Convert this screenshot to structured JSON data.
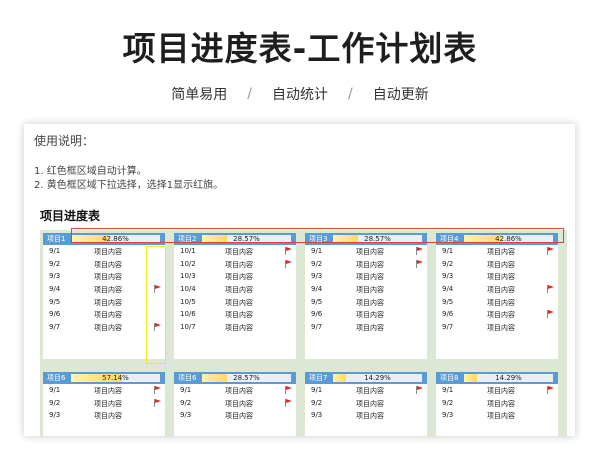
{
  "header": {
    "title": "项目进度表-工作计划表",
    "features": [
      "简单易用",
      "自动统计",
      "自动更新"
    ],
    "separator": "/"
  },
  "instructions": {
    "heading": "使用说明：",
    "lines": [
      "1. 红色框区域自动计算。",
      "2. 黄色框区域下拉选择，选择1显示红旗。"
    ]
  },
  "table_title": "项目进度表",
  "colors": {
    "header_bar": "#5b9bd5",
    "panel_bg": "#dde8d4",
    "flag": "#e02a20",
    "calc_box": "#e0423a",
    "select_box": "#f2ea1c"
  },
  "cards": [
    {
      "name": "项目1",
      "progress": "42.86%",
      "progress_value": 0.4286,
      "rows": [
        {
          "date": "9/1",
          "content": "项目内容",
          "flag": false
        },
        {
          "date": "9/2",
          "content": "项目内容",
          "flag": false
        },
        {
          "date": "9/3",
          "content": "项目内容",
          "flag": false
        },
        {
          "date": "9/4",
          "content": "项目内容",
          "flag": true
        },
        {
          "date": "9/5",
          "content": "项目内容",
          "flag": false
        },
        {
          "date": "9/6",
          "content": "项目内容",
          "flag": false
        },
        {
          "date": "9/7",
          "content": "项目内容",
          "flag": true
        }
      ]
    },
    {
      "name": "项目2",
      "progress": "28.57%",
      "progress_value": 0.2857,
      "rows": [
        {
          "date": "10/1",
          "content": "项目内容",
          "flag": true
        },
        {
          "date": "10/2",
          "content": "项目内容",
          "flag": true
        },
        {
          "date": "10/3",
          "content": "项目内容",
          "flag": false
        },
        {
          "date": "10/4",
          "content": "项目内容",
          "flag": false
        },
        {
          "date": "10/5",
          "content": "项目内容",
          "flag": false
        },
        {
          "date": "10/6",
          "content": "项目内容",
          "flag": false
        },
        {
          "date": "10/7",
          "content": "项目内容",
          "flag": false
        }
      ]
    },
    {
      "name": "项目3",
      "progress": "28.57%",
      "progress_value": 0.2857,
      "rows": [
        {
          "date": "9/1",
          "content": "项目内容",
          "flag": true
        },
        {
          "date": "9/2",
          "content": "项目内容",
          "flag": true
        },
        {
          "date": "9/3",
          "content": "项目内容",
          "flag": false
        },
        {
          "date": "9/4",
          "content": "项目内容",
          "flag": false
        },
        {
          "date": "9/5",
          "content": "项目内容",
          "flag": false
        },
        {
          "date": "9/6",
          "content": "项目内容",
          "flag": false
        },
        {
          "date": "9/7",
          "content": "项目内容",
          "flag": false
        }
      ]
    },
    {
      "name": "项目4",
      "progress": "42.86%",
      "progress_value": 0.4286,
      "rows": [
        {
          "date": "9/1",
          "content": "项目内容",
          "flag": true
        },
        {
          "date": "9/2",
          "content": "项目内容",
          "flag": false
        },
        {
          "date": "9/3",
          "content": "项目内容",
          "flag": false
        },
        {
          "date": "9/4",
          "content": "项目内容",
          "flag": true
        },
        {
          "date": "9/5",
          "content": "项目内容",
          "flag": false
        },
        {
          "date": "9/6",
          "content": "项目内容",
          "flag": true
        },
        {
          "date": "9/7",
          "content": "项目内容",
          "flag": false
        }
      ]
    },
    {
      "name": "项目6",
      "progress": "57.14%",
      "progress_value": 0.5714,
      "rows": [
        {
          "date": "9/1",
          "content": "项目内容",
          "flag": true
        },
        {
          "date": "9/2",
          "content": "项目内容",
          "flag": true
        },
        {
          "date": "9/3",
          "content": "项目内容",
          "flag": false
        }
      ]
    },
    {
      "name": "项目6",
      "progress": "28.57%",
      "progress_value": 0.2857,
      "rows": [
        {
          "date": "9/1",
          "content": "项目内容",
          "flag": true
        },
        {
          "date": "9/2",
          "content": "项目内容",
          "flag": true
        },
        {
          "date": "9/3",
          "content": "项目内容",
          "flag": false
        }
      ]
    },
    {
      "name": "项目7",
      "progress": "14.29%",
      "progress_value": 0.1429,
      "rows": [
        {
          "date": "9/1",
          "content": "项目内容",
          "flag": true
        },
        {
          "date": "9/2",
          "content": "项目内容",
          "flag": false
        },
        {
          "date": "9/3",
          "content": "项目内容",
          "flag": false
        }
      ]
    },
    {
      "name": "项目8",
      "progress": "14.29%",
      "progress_value": 0.1429,
      "rows": [
        {
          "date": "9/1",
          "content": "项目内容",
          "flag": true
        },
        {
          "date": "9/2",
          "content": "项目内容",
          "flag": false
        },
        {
          "date": "9/3",
          "content": "项目内容",
          "flag": false
        }
      ]
    }
  ]
}
